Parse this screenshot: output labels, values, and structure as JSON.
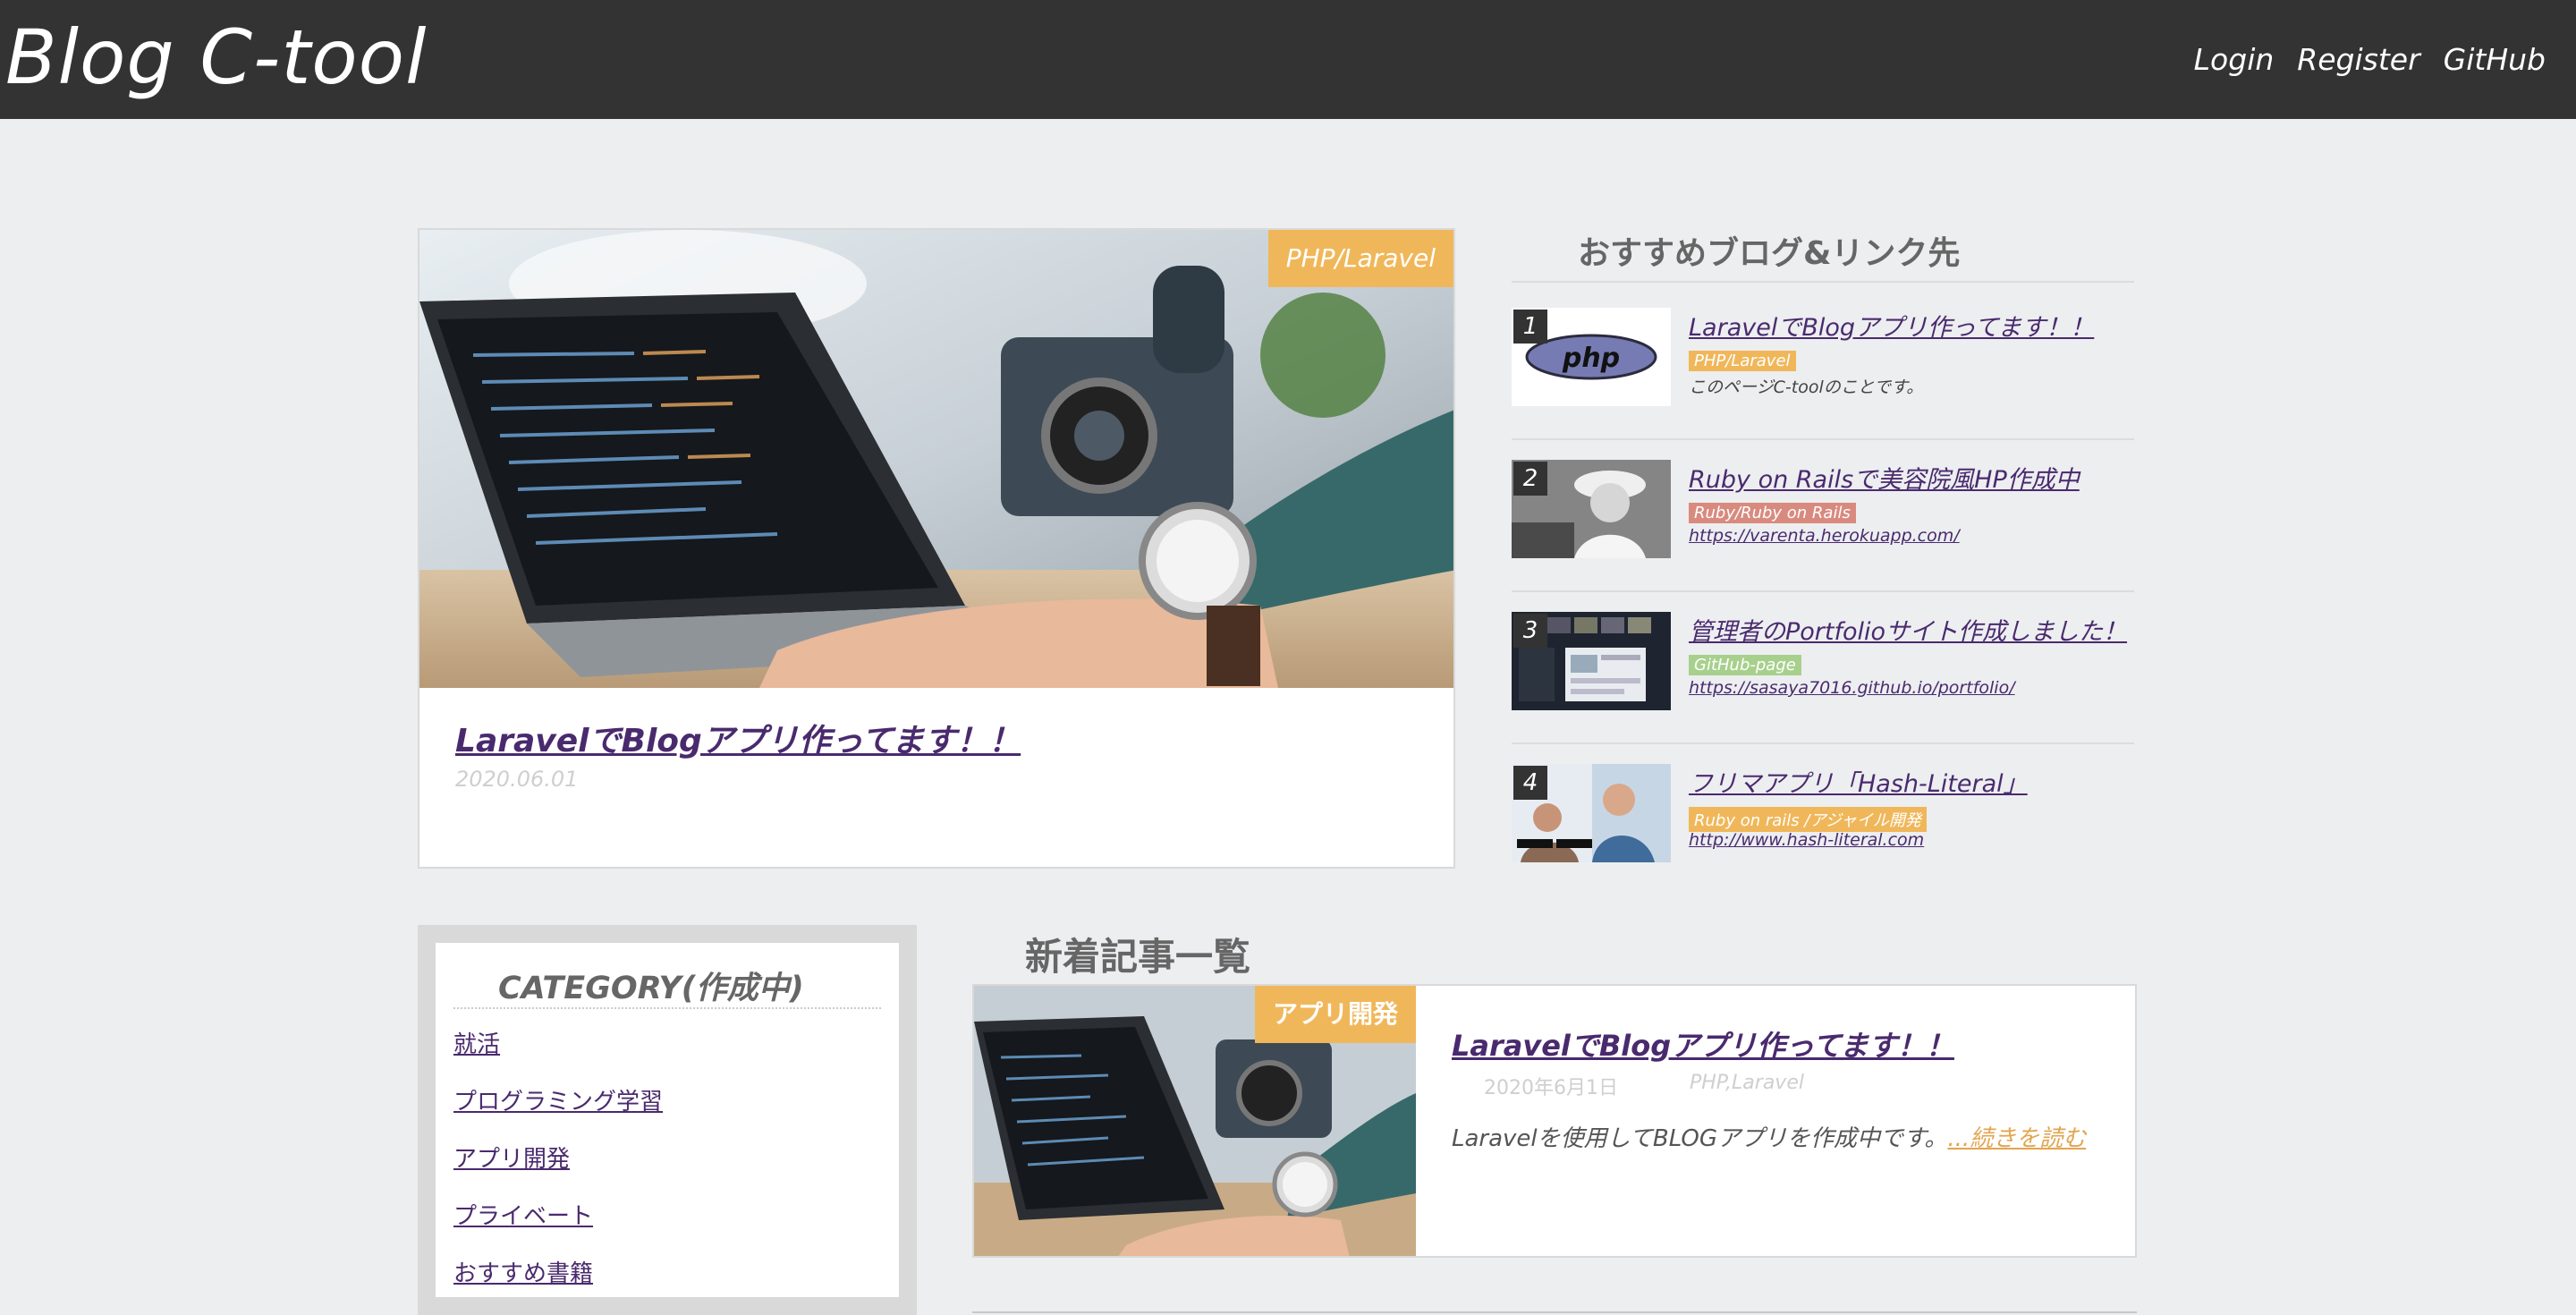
{
  "nav": {
    "brand": "Blog C-tool",
    "links": [
      "Login",
      "Register",
      "GitHub"
    ]
  },
  "featured": {
    "category": "PHP/Laravel",
    "title": "LaravelでBlogアプリ作ってます！！",
    "date": "2020.06.01"
  },
  "recommended": {
    "heading": "おすすめブログ&リンク先",
    "items": [
      {
        "num": "1",
        "title": "LaravelでBlogアプリ作ってます！！",
        "tag": "PHP/Laravel",
        "tag_color": "#f0b75a",
        "desc": "このページC-toolのことです。"
      },
      {
        "num": "2",
        "title": "Ruby on Railsで美容院風HP作成中",
        "tag": "Ruby/Ruby on Rails",
        "tag_color": "#d98a7e",
        "desc": "https://varenta.herokuapp.com/"
      },
      {
        "num": "3",
        "title": "管理者のPortfolioサイト作成しました！",
        "tag": "GitHub-page",
        "tag_color": "#a8d08d",
        "desc": "https://sasaya7016.github.io/portfolio/"
      },
      {
        "num": "4",
        "title": "フリマアプリ「Hash-Literal」",
        "tag": "Ruby on rails /アジャイル開発",
        "tag_color": "#f0b75a",
        "desc": "http://www.hash-literal.com"
      }
    ]
  },
  "categories": {
    "heading": "CATEGORY(作成中)",
    "items": [
      "就活",
      "プログラミング学習",
      "アプリ開発",
      "プライベート",
      "おすすめ書籍"
    ]
  },
  "new_posts": {
    "heading": "新着記事一覧",
    "post": {
      "badge": "アプリ開発",
      "title": "LaravelでBlogアプリ作ってます！！",
      "date": "2020年6月1日",
      "category": "PHP,Laravel",
      "excerpt": "Laravelを使用してBLOGアプリを作成中です。",
      "more": "...続きを読む"
    }
  },
  "colors": {
    "navbar": "#333333",
    "accent": "#f0b75a",
    "link": "#4a2a6e"
  }
}
